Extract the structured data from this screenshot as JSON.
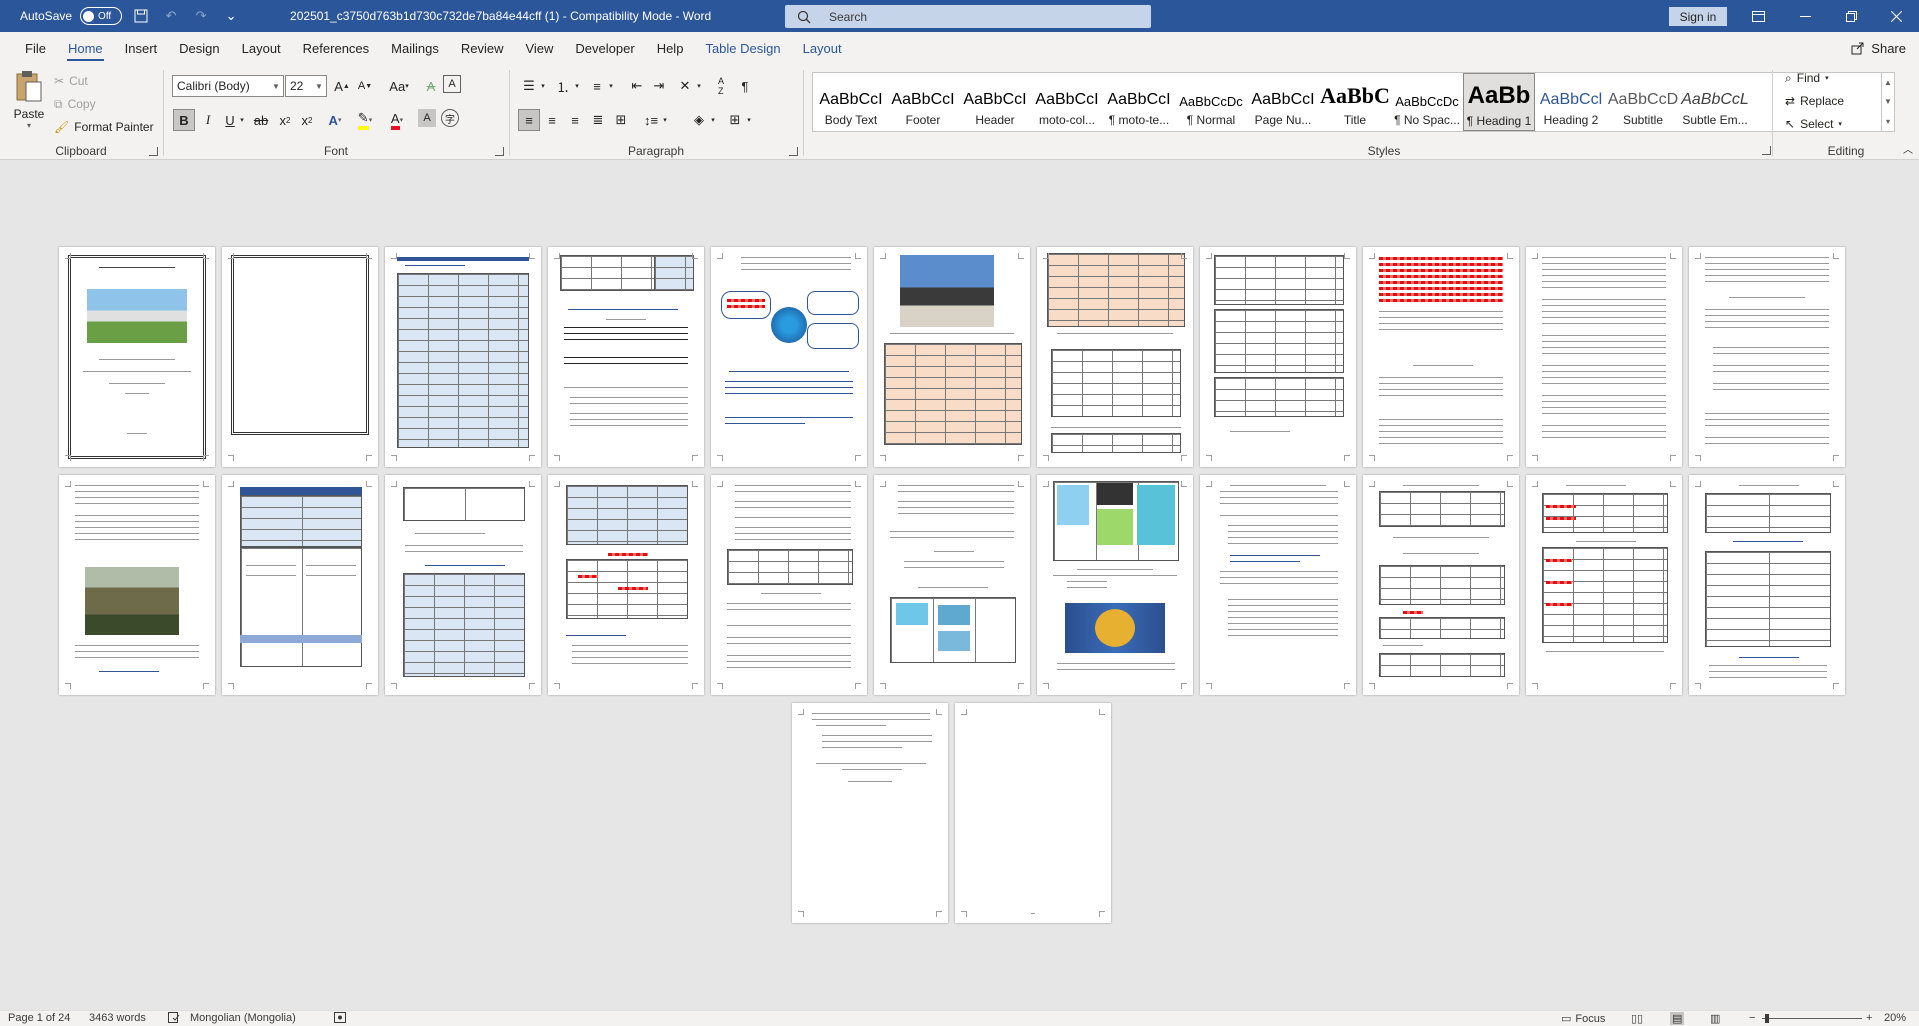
{
  "titlebar": {
    "autosave_label": "AutoSave",
    "autosave_state": "Off",
    "doc_title": "202501_c3750d763b1d730c732de7ba84e44cff (1)  -  Compatibility Mode  -  Word",
    "search_placeholder": "Search",
    "signin": "Sign in"
  },
  "tabs": [
    "File",
    "Home",
    "Insert",
    "Design",
    "Layout",
    "References",
    "Mailings",
    "Review",
    "View",
    "Developer",
    "Help",
    "Table Design",
    "Layout"
  ],
  "share": "Share",
  "clipboard": {
    "label": "Clipboard",
    "paste": "Paste",
    "cut": "Cut",
    "copy": "Copy",
    "format_painter": "Format Painter"
  },
  "font": {
    "label": "Font",
    "name": "Calibri (Body)",
    "size": "22"
  },
  "paragraph": {
    "label": "Paragraph"
  },
  "styles": {
    "label": "Styles",
    "items": [
      {
        "preview": "AaBbCcI",
        "name": "Body Text"
      },
      {
        "preview": "AaBbCcI",
        "name": "Footer"
      },
      {
        "preview": "AaBbCcI",
        "name": "Header"
      },
      {
        "preview": "AaBbCcI",
        "name": "moto-col..."
      },
      {
        "preview": "AaBbCcI",
        "name": "¶ moto-te..."
      },
      {
        "preview": "AaBbCcDc",
        "name": "¶ Normal"
      },
      {
        "preview": "AaBbCcI",
        "name": "Page Nu..."
      },
      {
        "preview": "AaBbC",
        "name": "Title"
      },
      {
        "preview": "AaBbCcDc",
        "name": "¶ No Spac..."
      },
      {
        "preview": "AaBb",
        "name": "¶ Heading 1"
      },
      {
        "preview": "AaBbCcl",
        "name": "Heading 2"
      },
      {
        "preview": "AaBbCcD",
        "name": "Subtitle"
      },
      {
        "preview": "AaBbCcL",
        "name": "Subtle Em..."
      }
    ]
  },
  "editing": {
    "label": "Editing",
    "find": "Find",
    "replace": "Replace",
    "select": "Select"
  },
  "status": {
    "page": "Page 1 of 24",
    "words": "3463 words",
    "language": "Mongolian (Mongolia)",
    "focus": "Focus",
    "zoom": "20%"
  }
}
